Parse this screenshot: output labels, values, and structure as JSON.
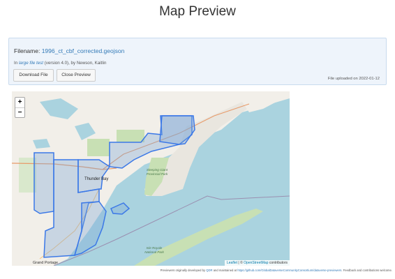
{
  "page": {
    "title": "Map Preview"
  },
  "file_info": {
    "filename_label": "Filename:",
    "filename": "1996_ct_cbf_corrected.geojson",
    "in_prefix": "In",
    "dataset_title": "large file test",
    "version_text": "(version 4.0), by Newson, Kaitlin",
    "upload_text": "File uploaded on 2022-01-12"
  },
  "buttons": {
    "download": "Download File",
    "close": "Close Preview"
  },
  "map": {
    "zoom_in": "+",
    "zoom_out": "−",
    "labels": {
      "city": "Thunder Bay",
      "sleeping_giant": "Sleeping Giant Provincial Park",
      "isle_royale": "Isle Royale National Park",
      "grand_portage": "Grand Portage"
    },
    "attribution": {
      "leaflet": "Leaflet",
      "separator": " | © ",
      "osm": "OpenStreetMap",
      "suffix": " contributors"
    },
    "colors": {
      "water": "#aad3df",
      "land": "#f2efe9",
      "park": "#c8e0b4",
      "boundary": "#3b78e7",
      "fill": "#7aa6d6"
    }
  },
  "footer": {
    "prefix": "Previewers originally developed by",
    "qdr": "QDR",
    "middle": "and maintained at",
    "repo_url": "https://github.com/GlobalDataverseCommunityConsortium/dataverse-previewers",
    "suffix": ". Feedback and contributions welcome."
  }
}
